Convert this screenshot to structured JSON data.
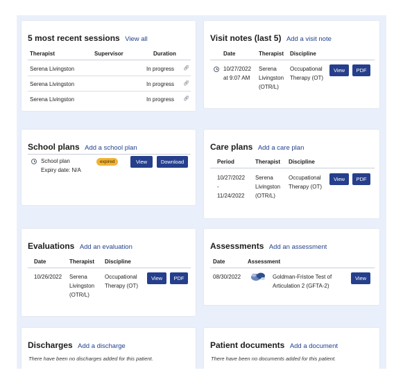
{
  "sessions": {
    "title": "5 most recent sessions",
    "link": "View all",
    "headers": [
      "Therapist",
      "Supervisor",
      "Duration"
    ],
    "rows": [
      {
        "therapist": "Serena Livingston",
        "supervisor": "",
        "duration": "In progress"
      },
      {
        "therapist": "Serena Livingston",
        "supervisor": "",
        "duration": "In progress"
      },
      {
        "therapist": "Serena Livingston",
        "supervisor": "",
        "duration": "In progress"
      }
    ],
    "row_icon": "link-icon"
  },
  "visit_notes": {
    "title": "Visit notes (last 5)",
    "link": "Add a visit note",
    "headers": [
      "Date",
      "Therapist",
      "Discipline"
    ],
    "rows": [
      {
        "date_line1": "10/27/2022",
        "date_line2": "at 9:07 AM",
        "therapist_line1": "Serena",
        "therapist_line2": "Livingston",
        "therapist_line3": "(OTR/L)",
        "discipline_line1": "Occupational",
        "discipline_line2": "Therapy (OT)",
        "view": "View",
        "pdf": "PDF"
      }
    ]
  },
  "school_plans": {
    "title": "School plans",
    "link": "Add a school plan",
    "item": {
      "name": "School plan",
      "expiry": "Expiry date: N/A",
      "badge": "expired",
      "view": "View",
      "download": "Download"
    }
  },
  "care_plans": {
    "title": "Care plans",
    "link": "Add a care plan",
    "headers": [
      "Period",
      "Therapist",
      "Discipline"
    ],
    "rows": [
      {
        "period_line1": "10/27/2022",
        "period_line2": "-",
        "period_line3": "11/24/2022",
        "therapist_line1": "Serena",
        "therapist_line2": "Livingston",
        "therapist_line3": "(OTR/L)",
        "discipline_line1": "Occupational",
        "discipline_line2": "Therapy (OT)",
        "view": "View",
        "pdf": "PDF"
      }
    ]
  },
  "evaluations": {
    "title": "Evaluations",
    "link": "Add an evaluation",
    "headers": [
      "Date",
      "Therapist",
      "Discipline"
    ],
    "rows": [
      {
        "date": "10/26/2022",
        "therapist_line1": "Serena",
        "therapist_line2": "Livingston",
        "therapist_line3": "(OTR/L)",
        "discipline_line1": "Occupational",
        "discipline_line2": "Therapy (OT)",
        "view": "View",
        "pdf": "PDF"
      }
    ]
  },
  "assessments": {
    "title": "Assessments",
    "link": "Add an assessment",
    "headers": [
      "Date",
      "Assessment"
    ],
    "rows": [
      {
        "date": "08/30/2022",
        "name_line1": "Goldman-Fristoe Test of",
        "name_line2": "Articulation 2 (GFTA-2)",
        "view": "View"
      }
    ]
  },
  "discharges": {
    "title": "Discharges",
    "link": "Add a discharge",
    "empty": "There have been no discharges added for this patient."
  },
  "patient_documents": {
    "title": "Patient documents",
    "link": "Add a document",
    "empty": "There have been no documents added for this patient."
  },
  "colors": {
    "background": "#eaf0fb",
    "button": "#263f8c",
    "link": "#23418f",
    "badge": "#f2b233"
  }
}
